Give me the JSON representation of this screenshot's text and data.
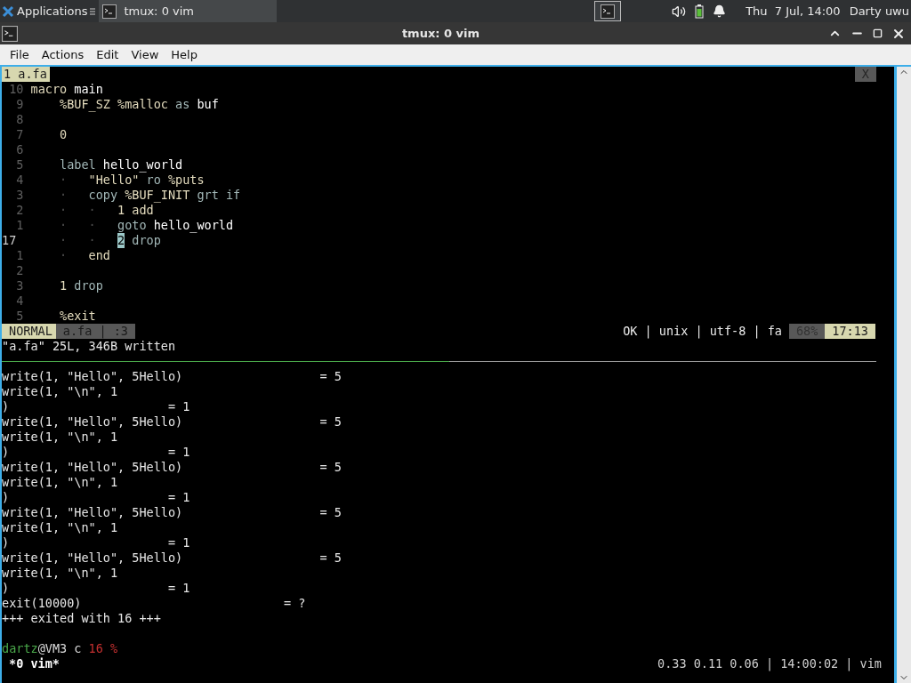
{
  "panel": {
    "apps_label": "Applications",
    "tasks": [
      {
        "title": "tmux: 0 vim",
        "selected": false
      }
    ],
    "clock": "Thu  7 Jul, 14:00",
    "user": "Darty uwu"
  },
  "window": {
    "title": "tmux: 0 vim"
  },
  "menu": [
    "File",
    "Actions",
    "Edit",
    "View",
    "Help"
  ],
  "vim": {
    "tabs": [
      {
        "label": "1 a.fa",
        "selected": true
      }
    ],
    "close_label": "X",
    "lines": [
      {
        "number": "10",
        "current": false,
        "tokens": [
          {
            "kind": "text",
            "text": "macro "
          },
          {
            "kind": "name",
            "text": "main"
          }
        ]
      },
      {
        "number": "9",
        "current": false,
        "tokens": [
          {
            "kind": "text",
            "text": "    %BUF_SZ %malloc "
          },
          {
            "kind": "keyword",
            "text": "as"
          },
          {
            "kind": "name",
            "text": " buf"
          }
        ]
      },
      {
        "number": "8",
        "current": false
      },
      {
        "number": "7",
        "current": false,
        "tokens": [
          {
            "kind": "text",
            "text": "    0"
          }
        ]
      },
      {
        "number": "6",
        "current": false
      },
      {
        "number": "5",
        "current": false,
        "tokens": [
          {
            "kind": "keyword",
            "text": "    label"
          },
          {
            "kind": "name",
            "text": " hello_world"
          }
        ]
      },
      {
        "number": "4",
        "current": false,
        "tokens": [
          {
            "kind": "guide",
            "text": "    ·   "
          },
          {
            "kind": "text",
            "text": "\"Hello\" "
          },
          {
            "kind": "keyword",
            "text": "ro"
          },
          {
            "kind": "text",
            "text": " %puts"
          }
        ]
      },
      {
        "number": "3",
        "current": false,
        "tokens": [
          {
            "kind": "guide",
            "text": "    ·   "
          },
          {
            "kind": "keyword",
            "text": "copy"
          },
          {
            "kind": "text",
            "text": " %BUF_INIT "
          },
          {
            "kind": "keyword",
            "text": "grt if"
          }
        ]
      },
      {
        "number": "2",
        "current": false,
        "tokens": [
          {
            "kind": "guide",
            "text": "    ·   ·   "
          },
          {
            "kind": "text",
            "text": "1 add"
          }
        ]
      },
      {
        "number": "1",
        "current": false,
        "tokens": [
          {
            "kind": "guide",
            "text": "    ·   ·   "
          },
          {
            "kind": "keyword",
            "text": "goto"
          },
          {
            "kind": "name",
            "text": " hello_world"
          }
        ]
      },
      {
        "number": "17",
        "current": true,
        "tokens": [
          {
            "kind": "guide",
            "text": "    ·   ·   "
          },
          {
            "kind": "cursor",
            "text": "2"
          },
          {
            "kind": "keyword",
            "text": " drop"
          }
        ]
      },
      {
        "number": "1",
        "current": false,
        "tokens": [
          {
            "kind": "guide",
            "text": "    ·   "
          },
          {
            "kind": "text",
            "text": "end"
          }
        ]
      },
      {
        "number": "2",
        "current": false
      },
      {
        "number": "3",
        "current": false,
        "tokens": [
          {
            "kind": "text",
            "text": "    1 "
          },
          {
            "kind": "keyword",
            "text": "drop"
          }
        ]
      },
      {
        "number": "4",
        "current": false
      },
      {
        "number": "5",
        "current": false,
        "tokens": [
          {
            "kind": "text",
            "text": "    %exit"
          }
        ]
      }
    ],
    "status": {
      "mode": "NORMAL",
      "file": "a.fa | :3",
      "info": "OK | unix | utf-8 | fa",
      "percent": "68%",
      "position": "17:13"
    },
    "message": "\"a.fa\" 25L, 346B written"
  },
  "output": [
    "write(1, \"Hello\", 5Hello)                   = 5",
    "write(1, \"\\n\", 1",
    ")                      = 1",
    "write(1, \"Hello\", 5Hello)                   = 5",
    "write(1, \"\\n\", 1",
    ")                      = 1",
    "write(1, \"Hello\", 5Hello)                   = 5",
    "write(1, \"\\n\", 1",
    ")                      = 1",
    "write(1, \"Hello\", 5Hello)                   = 5",
    "write(1, \"\\n\", 1",
    ")                      = 1",
    "write(1, \"Hello\", 5Hello)                   = 5",
    "write(1, \"\\n\", 1",
    ")                      = 1",
    "exit(10000)                            = ?",
    "+++ exited with 16 +++"
  ],
  "prompt": [
    {
      "kind": "user",
      "text": "dartz"
    },
    {
      "kind": "plain",
      "text": "@VM3 c "
    },
    {
      "kind": "code",
      "text": "16 %"
    }
  ],
  "tmux_status": {
    "windows": "*0 vim*",
    "right": "0.33 0.11 0.06 | 14:00:02 | vim"
  }
}
